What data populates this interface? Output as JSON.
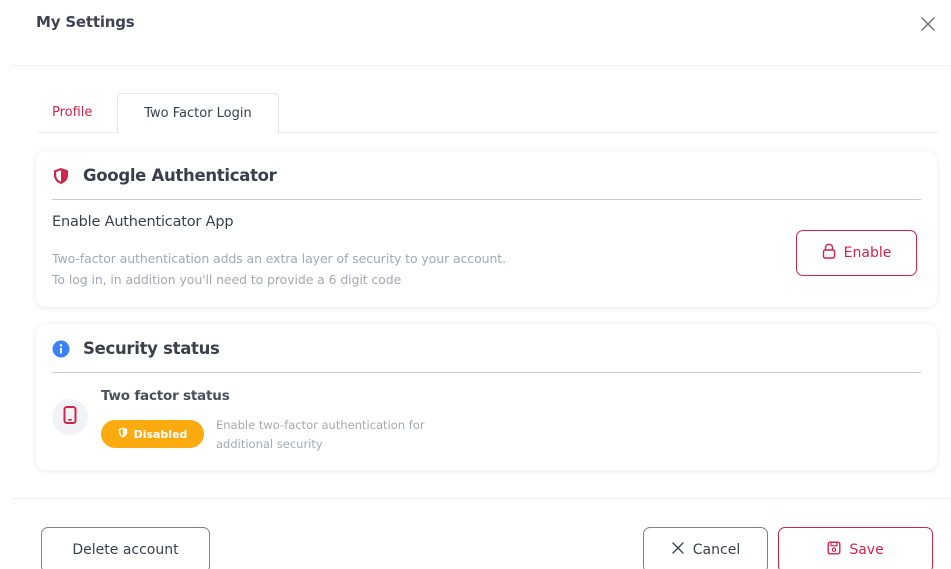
{
  "modal": {
    "title": "My Settings"
  },
  "tabs": [
    {
      "label": "Profile",
      "active": false
    },
    {
      "label": "Two Factor Login",
      "active": true
    }
  ],
  "google_authenticator": {
    "heading": "Google Authenticator",
    "icon": "shield-icon",
    "subtitle": "Enable Authenticator App",
    "description_line1": "Two-factor authentication adds an extra layer of security to your account.",
    "description_line2": "To log in, in addition you'll need to provide a 6 digit code",
    "enable_label": "Enable",
    "enable_icon": "lock-icon"
  },
  "security_status": {
    "heading": "Security status",
    "icon": "info-icon",
    "status_title": "Two factor status",
    "status_icon": "phone-icon",
    "badge_label": "Disabled",
    "badge_color": "#fbaa10",
    "description": "Enable two-factor authentication for additional security"
  },
  "footer": {
    "delete_label": "Delete account",
    "cancel_label": "Cancel",
    "save_label": "Save"
  },
  "colors": {
    "accent": "#d0244b",
    "info": "#3b82f6",
    "warning": "#fbaa10"
  }
}
